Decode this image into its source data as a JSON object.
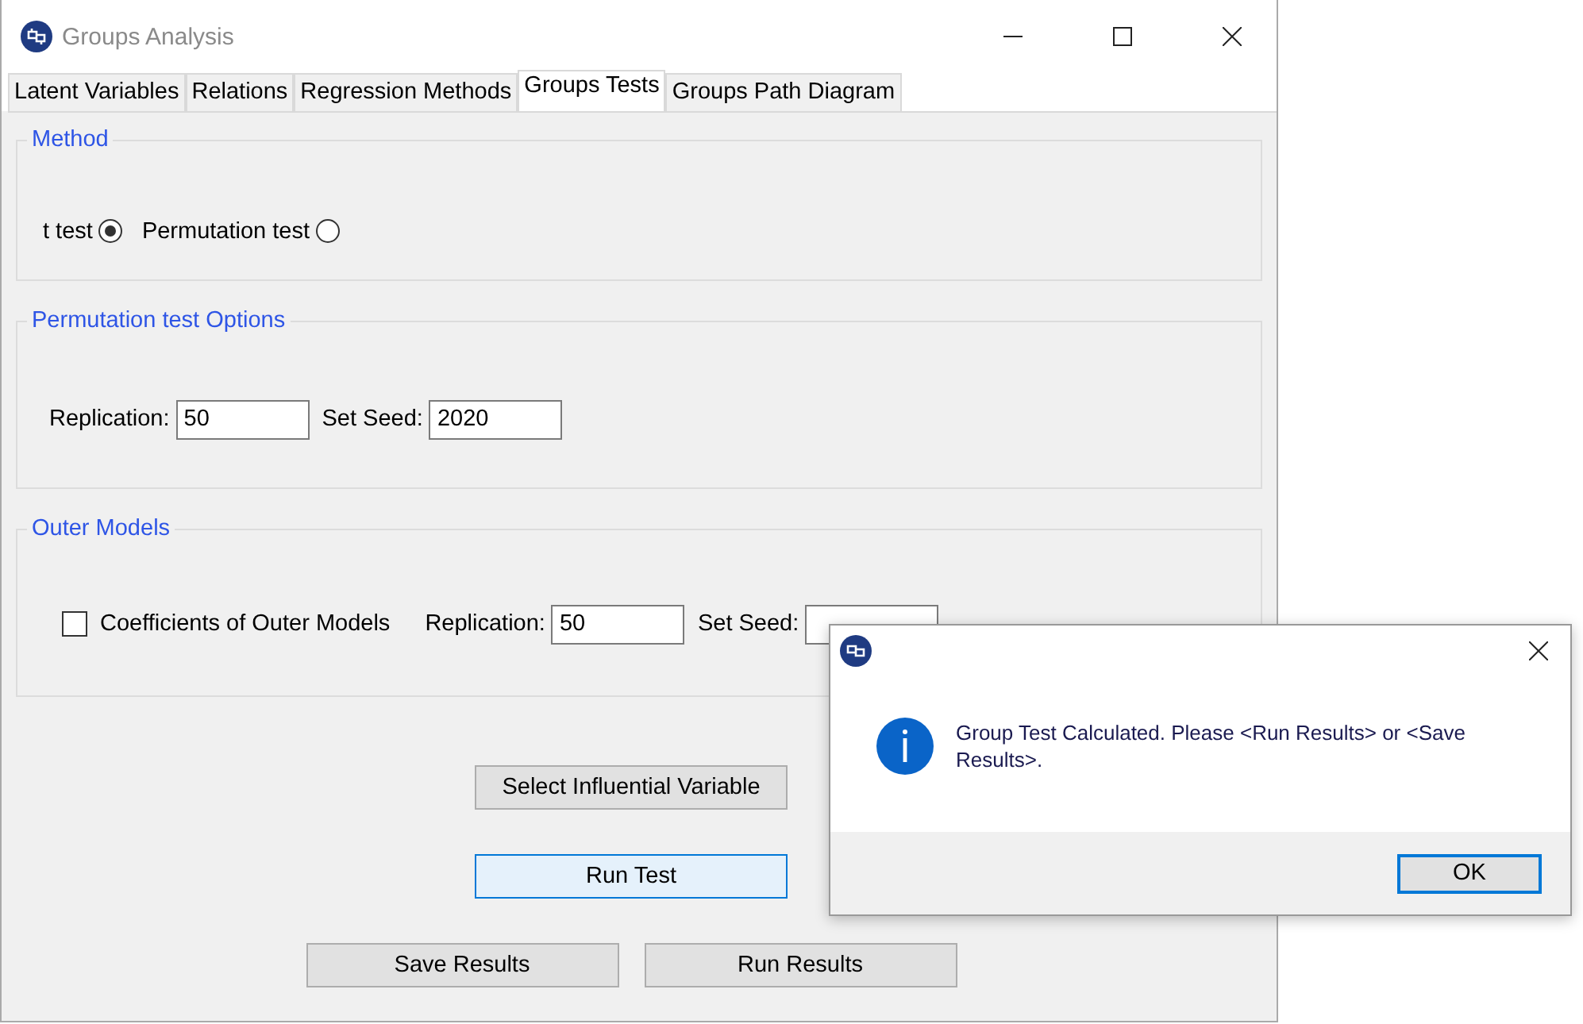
{
  "window": {
    "title": "Groups Analysis"
  },
  "tabs": [
    {
      "label": "Latent Variables",
      "selected": false
    },
    {
      "label": "Relations",
      "selected": false
    },
    {
      "label": "Regression Methods",
      "selected": false
    },
    {
      "label": "Groups Tests",
      "selected": true
    },
    {
      "label": "Groups Path Diagram",
      "selected": false
    }
  ],
  "method": {
    "title": "Method",
    "options": [
      {
        "label": "t test",
        "selected": true
      },
      {
        "label": "Permutation test",
        "selected": false
      }
    ]
  },
  "permutation_options": {
    "title": "Permutation test Options",
    "fields": [
      {
        "label": "Replication:",
        "value": "50"
      },
      {
        "label": "Set Seed:",
        "value": "2020"
      }
    ]
  },
  "outer_models": {
    "title": "Outer Models",
    "checkbox": {
      "label": "Coefficients of Outer Models",
      "checked": false
    },
    "fields": [
      {
        "label": "Replication:",
        "value": "50"
      },
      {
        "label": "Set Seed:"
      }
    ]
  },
  "button_rows": [
    [
      {
        "label": "Select Influential Variable",
        "focused": false
      }
    ],
    [
      {
        "label": "Run Test",
        "focused": true
      }
    ],
    [
      {
        "label": "Save Results",
        "focused": false
      },
      {
        "label": "Run Results",
        "focused": false
      }
    ]
  ],
  "dialog": {
    "message": "Group Test Calculated. Please <Run Results> or <Save Results>.",
    "button": "OK"
  }
}
